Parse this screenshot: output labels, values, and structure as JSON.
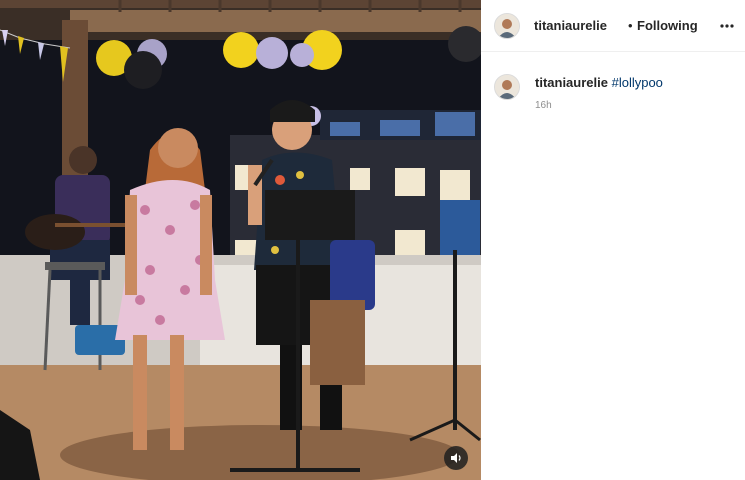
{
  "post": {
    "username": "titaniaurelie",
    "separator": "•",
    "follow_status": "Following",
    "more_icon": "more-horizontal-icon"
  },
  "caption": {
    "username": "titaniaurelie",
    "hashtag": "#lollypoo",
    "timestamp": "16h"
  },
  "media": {
    "type": "video",
    "sound_icon": "speaker-icon"
  },
  "colors": {
    "link": "#00376b",
    "muted_text": "#8e8e8e",
    "divider": "#efefef"
  }
}
